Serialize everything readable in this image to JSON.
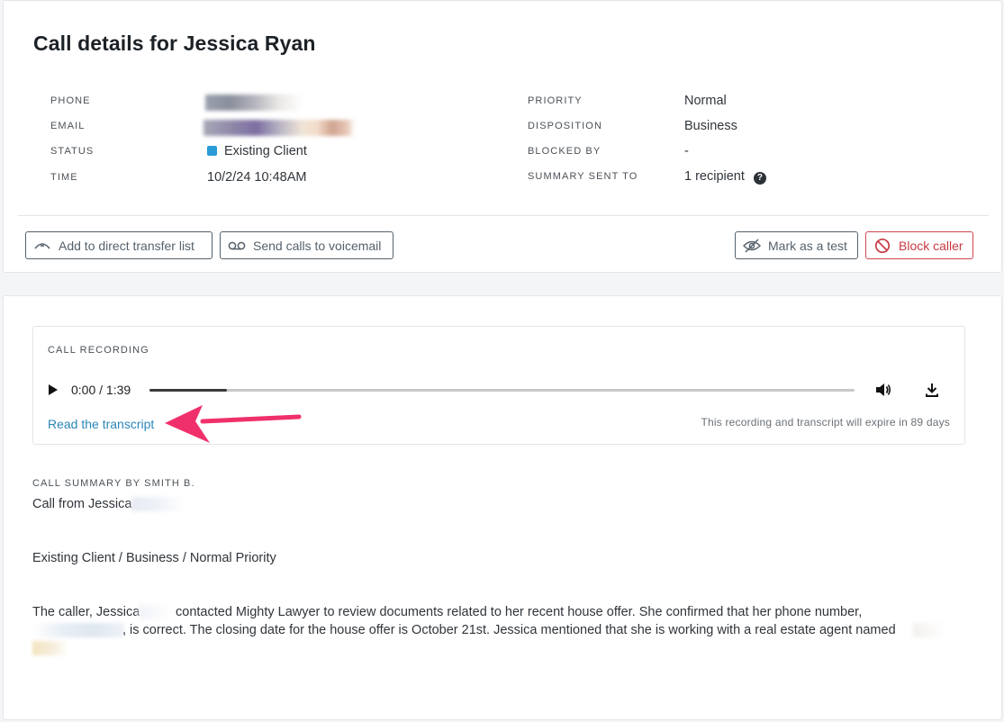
{
  "page": {
    "title": "Call details for Jessica Ryan"
  },
  "details_left": [
    {
      "label": "PHONE",
      "value": ""
    },
    {
      "label": "EMAIL",
      "value": ""
    },
    {
      "label": "STATUS",
      "value": "Existing Client"
    },
    {
      "label": "TIME",
      "value": "10/2/24 10:48AM"
    }
  ],
  "details_right": [
    {
      "label": "PRIORITY",
      "value": "Normal"
    },
    {
      "label": "DISPOSITION",
      "value": "Business"
    },
    {
      "label": "BLOCKED BY",
      "value": "-"
    },
    {
      "label": "SUMMARY SENT TO",
      "value": "1 recipient"
    }
  ],
  "colors": {
    "status_existing_client": "#2a9bd6",
    "link": "#2b87b8",
    "danger": "#c93a44",
    "annotation_arrow": "#f0306a"
  },
  "actions": {
    "add_direct_transfer": "Add to direct transfer list",
    "send_voicemail": "Send calls to voicemail",
    "mark_test": "Mark as a test",
    "block_caller": "Block caller"
  },
  "icons": {
    "add_direct_transfer": "transfer-icon",
    "send_voicemail": "voicemail-icon",
    "mark_test": "eye-off-icon",
    "block_caller": "block-icon",
    "help": "help-circle-icon",
    "play": "play-icon",
    "volume": "volume-icon",
    "download": "download-icon"
  },
  "recording": {
    "label": "CALL RECORDING",
    "time": "0:00 / 1:39",
    "progress": 0.11,
    "transcript_link": "Read the transcript",
    "expiry": "This recording and transcript will expire in 89 days"
  },
  "summary": {
    "heading": "CALL SUMMARY BY SMITH B.",
    "line1": "Call from Jessica",
    "line2": "Existing Client / Business / Normal Priority",
    "para_a": "The caller, Jessica",
    "para_b": "contacted Mighty Lawyer to review documents related to her recent house offer. She confirmed that her phone number,",
    "para_c": ", is correct. The closing date for the house offer is October 21st. Jessica mentioned that she is working with a real estate agent named"
  }
}
